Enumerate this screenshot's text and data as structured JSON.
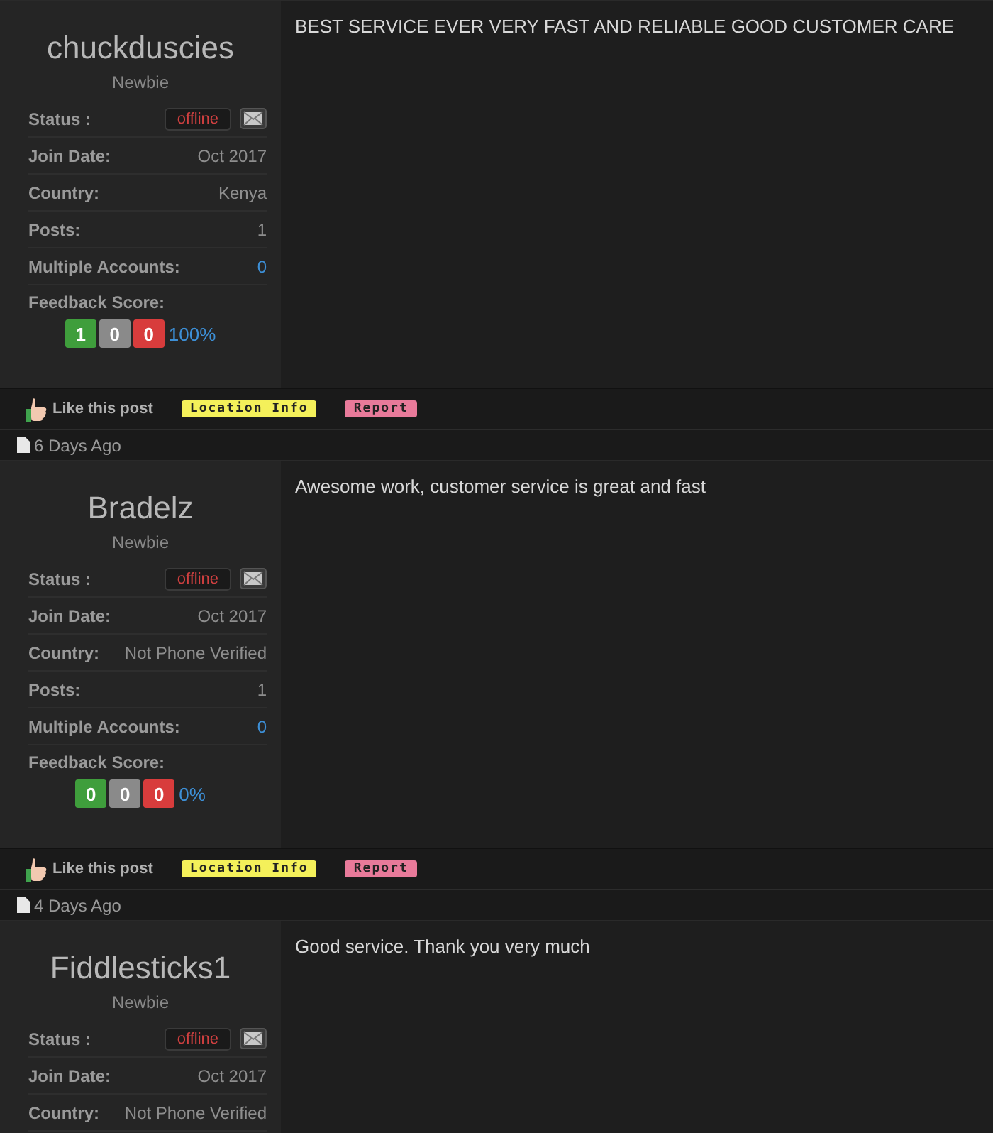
{
  "posts": [
    {
      "author": {
        "name": "chuckduscies",
        "rank": "Newbie",
        "status_label": "Status :",
        "status": "offline",
        "fields": [
          {
            "label": "Join Date:",
            "value": "Oct 2017",
            "kind": "plain"
          },
          {
            "label": "Country:",
            "value": "Kenya",
            "kind": "plain"
          },
          {
            "label": "Posts:",
            "value": "1",
            "kind": "plain"
          },
          {
            "label": "Multiple Accounts:",
            "value": "0",
            "kind": "link"
          }
        ],
        "feedback": {
          "label": "Feedback Score:",
          "positive": "1",
          "neutral": "0",
          "negative": "0",
          "percent": "100%"
        }
      },
      "message": "BEST SERVICE EVER VERY FAST AND RELIABLE GOOD CUSTOMER CARE",
      "actions": {
        "like": "Like this post",
        "location": "Location Info",
        "report": "Report"
      }
    },
    {
      "date": "6 Days Ago",
      "author": {
        "name": "Bradelz",
        "rank": "Newbie",
        "status_label": "Status :",
        "status": "offline",
        "fields": [
          {
            "label": "Join Date:",
            "value": "Oct 2017",
            "kind": "plain"
          },
          {
            "label": "Country:",
            "value": "Not Phone Verified",
            "kind": "plain"
          },
          {
            "label": "Posts:",
            "value": "1",
            "kind": "plain"
          },
          {
            "label": "Multiple Accounts:",
            "value": "0",
            "kind": "link"
          }
        ],
        "feedback": {
          "label": "Feedback Score:",
          "positive": "0",
          "neutral": "0",
          "negative": "0",
          "percent": "0%"
        }
      },
      "message": "Awesome work, customer service is great and fast",
      "actions": {
        "like": "Like this post",
        "location": "Location Info",
        "report": "Report"
      }
    },
    {
      "date": "4 Days Ago",
      "author": {
        "name": "Fiddlesticks1",
        "rank": "Newbie",
        "status_label": "Status :",
        "status": "offline",
        "fields": [
          {
            "label": "Join Date:",
            "value": "Oct 2017",
            "kind": "plain"
          },
          {
            "label": "Country:",
            "value": "Not Phone Verified",
            "kind": "plain"
          }
        ]
      },
      "message": "Good service. Thank you very much"
    }
  ]
}
